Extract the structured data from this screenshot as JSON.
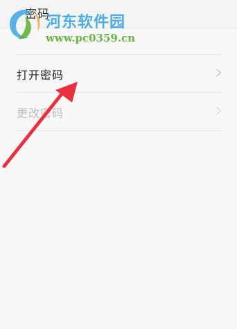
{
  "header": {
    "title": "密码"
  },
  "settings": {
    "items": [
      {
        "label": "打开密码",
        "enabled": true
      },
      {
        "label": "更改密码",
        "enabled": false
      }
    ]
  },
  "watermark": {
    "site_name": "河东软件园",
    "url": "www.pc0359.cn"
  },
  "colors": {
    "watermark_blue": "#3aa6e4",
    "watermark_green": "#5cb030",
    "annotation_arrow": "#e8303f",
    "disabled_text": "#bdbdbd"
  },
  "icons": {
    "row_chevron": "chevron-right-icon",
    "watermark_logo": "swirl-logo-icon"
  }
}
